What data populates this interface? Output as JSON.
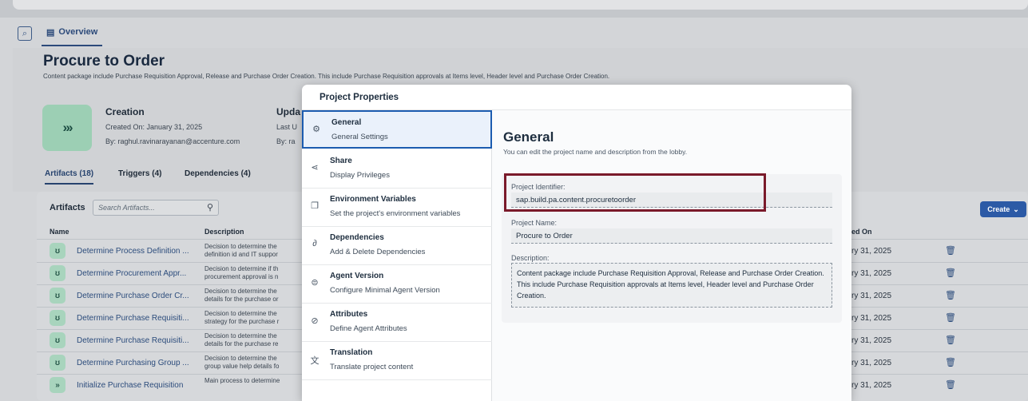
{
  "tabs": {
    "overview": "Overview"
  },
  "project": {
    "title": "Procure to Order",
    "description": "Content package include Purchase Requisition Approval, Release and Purchase Order Creation. This include Purchase Requisition approvals at Items level, Header level and Purchase Order Creation.",
    "avatar_glyph": "»›",
    "creation": {
      "heading": "Creation",
      "created_on": "Created On: January 31, 2025",
      "created_by": "By: raghul.ravinarayanan@accenture.com"
    },
    "update": {
      "heading": "Upda",
      "last": "Last U",
      "by": "By: ra"
    }
  },
  "subtabs": {
    "artifacts": "Artifacts (18)",
    "triggers": "Triggers (4)",
    "dependencies": "Dependencies (4)"
  },
  "artifacts": {
    "label": "Artifacts",
    "search_placeholder": "Search Artifacts...",
    "create_label": "Create",
    "columns": {
      "name": "Name",
      "description": "Description",
      "changed_on": "ed On"
    },
    "rows": [
      {
        "name": "Determine Process Definition ...",
        "desc1": "Decision to determine the",
        "desc2": "definition id and IT suppor",
        "date": "ry 31, 2025"
      },
      {
        "name": "Determine Procurement Appr...",
        "desc1": "Decision to determine if th",
        "desc2": "procurement approval is n",
        "date": "ry 31, 2025"
      },
      {
        "name": "Determine Purchase Order Cr...",
        "desc1": "Decision to determine the",
        "desc2": "details for the purchase or",
        "date": "ry 31, 2025"
      },
      {
        "name": "Determine Purchase Requisiti...",
        "desc1": "Decision to determine the",
        "desc2": "strategy for the purchase r",
        "date": "ry 31, 2025"
      },
      {
        "name": "Determine Purchase Requisiti...",
        "desc1": "Decision to determine the",
        "desc2": "details for the purchase re",
        "date": "ry 31, 2025"
      },
      {
        "name": "Determine Purchasing Group ...",
        "desc1": "Decision to determine the",
        "desc2": "group value help details fo",
        "date": "ry 31, 2025"
      },
      {
        "name": "Initialize Purchase Requisition",
        "desc1": "Main process to determine",
        "desc2": "",
        "date": "ry 31, 2025"
      }
    ]
  },
  "modal": {
    "title": "Project Properties",
    "nav": [
      {
        "title": "General",
        "subtitle": "General Settings",
        "icon": "gear-icon"
      },
      {
        "title": "Share",
        "subtitle": "Display Privileges",
        "icon": "share-icon"
      },
      {
        "title": "Environment Variables",
        "subtitle": "Set the project's environment variables",
        "icon": "document-icon"
      },
      {
        "title": "Dependencies",
        "subtitle": "Add & Delete Dependencies",
        "icon": "link-icon"
      },
      {
        "title": "Agent Version",
        "subtitle": "Configure Minimal Agent Version",
        "icon": "agent-icon"
      },
      {
        "title": "Attributes",
        "subtitle": "Define Agent Attributes",
        "icon": "tag-icon"
      },
      {
        "title": "Translation",
        "subtitle": "Translate project content",
        "icon": "translate-icon"
      }
    ],
    "general": {
      "heading": "General",
      "subheading": "You can edit the project name and description from the lobby.",
      "identifier_label": "Project Identifier:",
      "identifier_value": "sap.build.pa.content.procuretoorder",
      "name_label": "Project Name:",
      "name_value": "Procure to Order",
      "description_label": "Description:",
      "description_value": "Content package include Purchase Requisition Approval, Release and Purchase Order Creation. This include Purchase Requisition approvals at Items level, Header level and Purchase Order Creation."
    }
  },
  "colors": {
    "accent": "#1c5cb0",
    "highlight": "#7a1a2a",
    "brand_button": "#2c5aa6"
  }
}
